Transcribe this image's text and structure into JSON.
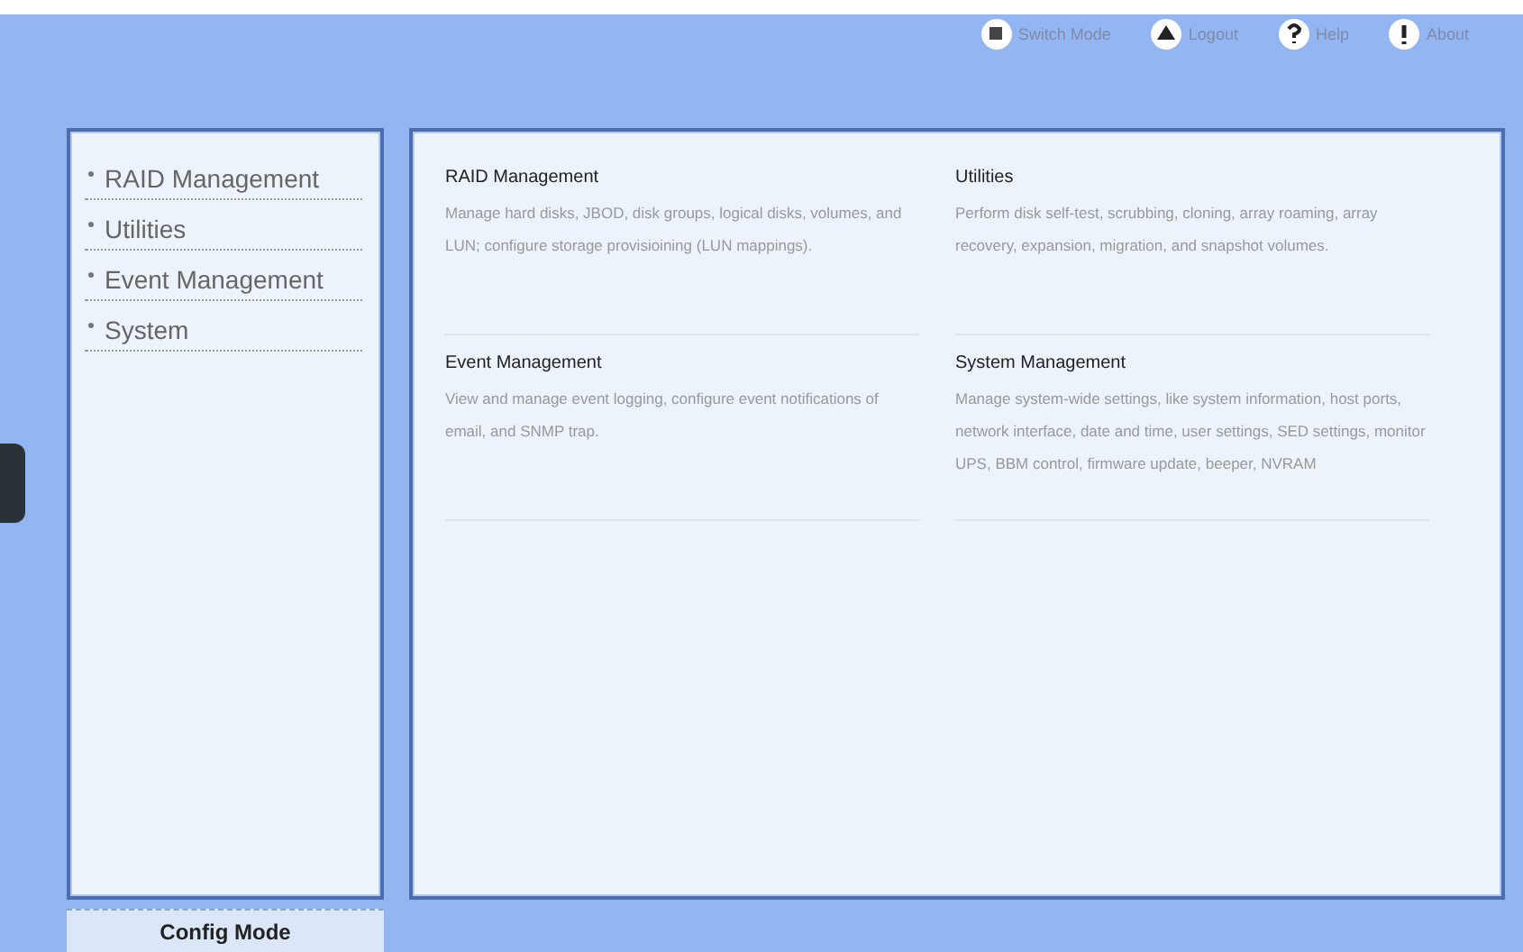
{
  "toolbar": [
    {
      "kind": "switch",
      "label": "Switch Mode"
    },
    {
      "kind": "logout",
      "label": "Logout"
    },
    {
      "kind": "help",
      "label": "Help"
    },
    {
      "kind": "about",
      "label": "About"
    }
  ],
  "sidebar": {
    "items": [
      {
        "label": "RAID Management"
      },
      {
        "label": "Utilities"
      },
      {
        "label": "Event Management"
      },
      {
        "label": "System"
      }
    ]
  },
  "sections": [
    {
      "title": "RAID Management",
      "description": "Manage hard disks, JBOD, disk groups, logical disks, volumes, and LUN; configure storage provisioining (LUN mappings)."
    },
    {
      "title": "Utilities",
      "description": "Perform disk self-test, scrubbing, cloning, array roaming, array recovery, expansion, migration, and snapshot volumes."
    },
    {
      "title": "Event Management",
      "description": "View and manage event logging, configure event notifications of email, and SNMP trap."
    },
    {
      "title": "System Management",
      "description": "Manage system-wide settings, like system information, host ports, network interface, date and time, user settings, SED settings, monitor UPS, BBM control, firmware update, beeper, NVRAM"
    }
  ],
  "mode_tab": {
    "label": "Config Mode"
  }
}
